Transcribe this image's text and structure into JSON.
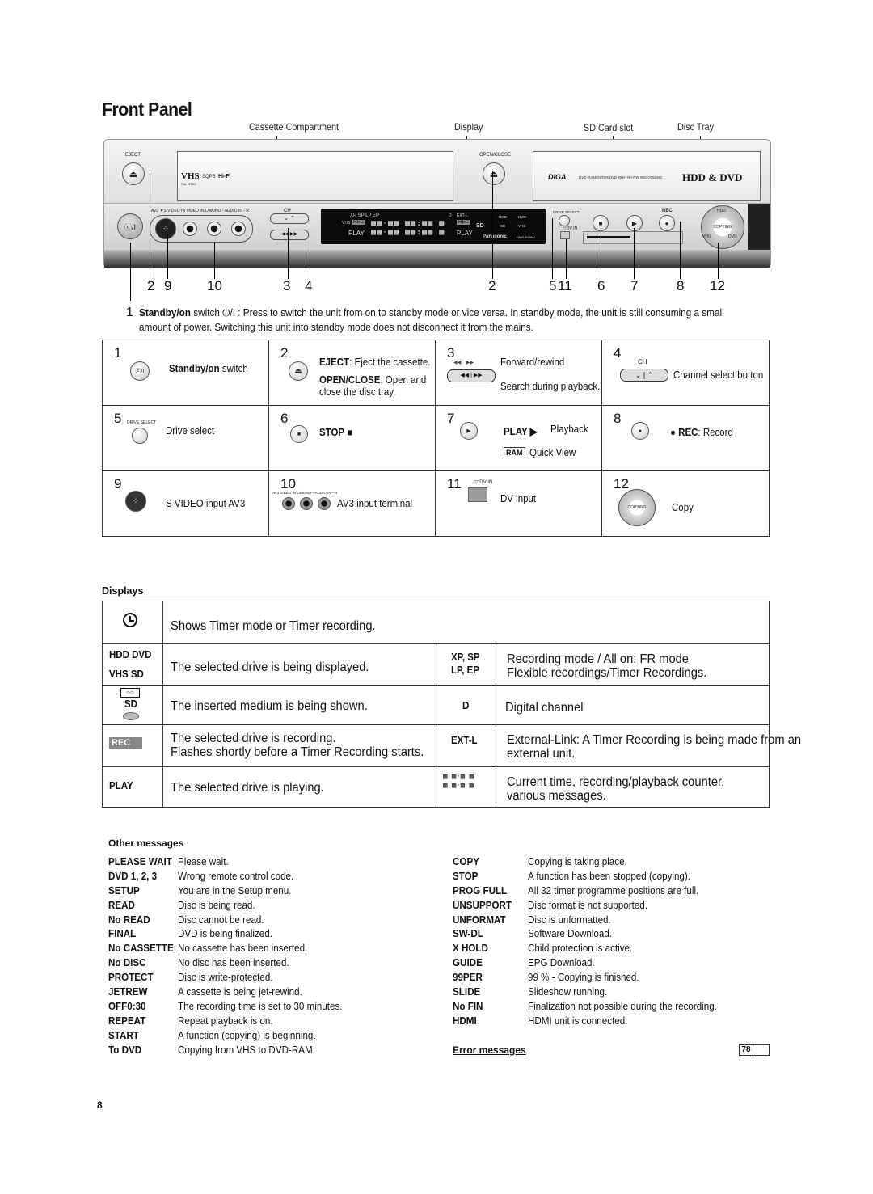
{
  "page_title": "Front Panel",
  "callouts_top": [
    "Cassette Compartment",
    "Display",
    "SD Card slot",
    "Disc Tray"
  ],
  "device": {
    "eject_label": "EJECT",
    "open_close_label": "OPEN/CLOSE",
    "vhs_logo": "VHS",
    "vhs_sub": "PAL NTSC",
    "sqpb": "SQPB",
    "hifi": "Hi-Fi",
    "brand": "DIGA",
    "formats": "DVD-RAM/DVD-R/DVD-RW/+R/+RW RECORDING",
    "hdd_dvd": "HDD & DVD",
    "av3_labels": "AV3  ▼S VIDEO IN  VIDEO IN  L/MONO - AUDIO IN - R",
    "ch_label": "CH",
    "standby_label": "ⓒ/I",
    "drive_select_label": "DRIVE SELECT",
    "dv_in_label": "▽DV IN",
    "rec_label": "REC",
    "copy_dial": {
      "top": "HDD",
      "center": "COPYING",
      "left": "VHS",
      "right": "DVD"
    },
    "lcd": {
      "modes": "XP SP  LP  EP",
      "d": "D",
      "extl": "EXT-L",
      "vhs": "VHS",
      "rec": "REC",
      "play": "PLAY",
      "sd": "SD",
      "drives": [
        "HDD",
        "DVD",
        "SD",
        "VHS"
      ],
      "maker": "Panasonic",
      "model": "DMR-EX95V"
    }
  },
  "callouts_bottom": [
    "1",
    "2",
    "9",
    "10",
    "3",
    "4",
    "2",
    "5",
    "11",
    "6",
    "7",
    "8",
    "12"
  ],
  "intro": {
    "number": "1",
    "bold": "Standby/on",
    "text": " switch ⏻/I : Press to switch the unit from on to standby mode or vice versa. In standby mode, the unit is still consuming a small",
    "text2": "amount of power. Switching this unit into standby mode does not disconnect it from the mains."
  },
  "grid": [
    {
      "n": "1",
      "icon": "standby-button-icon",
      "icon_text": "ⓒ/I",
      "bold": "Standby/on",
      "text": " switch"
    },
    {
      "n": "2",
      "icon": "eject-button-icon",
      "line1_bold": "EJECT",
      "line1": ": Eject the cassette.",
      "line2_bold": "OPEN/CLOSE",
      "line2": ": Open and",
      "line3": "close the disc tray."
    },
    {
      "n": "3",
      "icon": "rewind-forward-button-icon",
      "line1": "Forward/rewind",
      "line2": "Search during playback."
    },
    {
      "n": "4",
      "icon": "channel-button-icon",
      "icon_label": "CH",
      "text": "Channel select button"
    },
    {
      "n": "5",
      "icon": "drive-select-button-icon",
      "icon_label": "DRIVE SELECT",
      "text": "Drive select"
    },
    {
      "n": "6",
      "icon": "stop-button-icon",
      "bold": "STOP ■"
    },
    {
      "n": "7",
      "icon": "play-button-icon",
      "bold": "PLAY ▶",
      "text": "Playback",
      "badge": "RAM",
      "text2": "Quick View"
    },
    {
      "n": "8",
      "icon": "record-button-icon",
      "bold_prefix": "● REC",
      "text": ": Record"
    },
    {
      "n": "9",
      "icon": "s-video-terminal-icon",
      "text": "S VIDEO input AV3"
    },
    {
      "n": "10",
      "icon": "av3-terminals-icon",
      "icon_label": "AV3 VIDEO IN   L/MONO—AUDIO IN—R",
      "text": "AV3 input terminal"
    },
    {
      "n": "11",
      "icon": "dv-input-icon",
      "icon_label": "▽ DV IN",
      "text": "DV input"
    },
    {
      "n": "12",
      "icon": "copy-dial-icon",
      "text": "Copy"
    }
  ],
  "displays": {
    "heading": "Displays",
    "rows": [
      {
        "symbol": "timer-icon",
        "text": "Shows Timer mode or Timer recording."
      },
      {
        "symbol_lines": [
          "HDD   DVD",
          "VHS    SD"
        ],
        "text": "The selected drive is being displayed.",
        "right_symbol_lines": [
          "XP, SP",
          "LP, EP"
        ],
        "right_text": [
          "Recording mode / All on: FR mode",
          "Flexible recordings/Timer Recordings."
        ]
      },
      {
        "symbol_lines": [
          "SD"
        ],
        "text": "The inserted medium is being shown.",
        "right_symbol_lines": [
          "D"
        ],
        "right_text": [
          "Digital channel"
        ]
      },
      {
        "symbol_badge": "REC",
        "text_lines": [
          "The selected drive is recording.",
          "Flashes shortly before a Timer Recording starts."
        ],
        "right_symbol_lines": [
          "EXT-L"
        ],
        "right_text": [
          "External-Link: A Timer Recording is being made from an",
          "external unit."
        ]
      },
      {
        "symbol_lines": [
          "PLAY"
        ],
        "text": "The selected drive is playing.",
        "right_symbol": "segment-display-icon",
        "right_text": [
          "Current time, recording/playback counter,",
          "various messages."
        ]
      }
    ]
  },
  "other_messages": {
    "heading": "Other messages",
    "left": [
      {
        "k": "PLEASE WAIT",
        "v": "Please wait."
      },
      {
        "k": "DVD 1, 2, 3",
        "v": "Wrong remote control code."
      },
      {
        "k": "SETUP",
        "v": "You are in the Setup menu."
      },
      {
        "k": "READ",
        "v": "Disc is being read."
      },
      {
        "k": "No READ",
        "v": "Disc cannot be read."
      },
      {
        "k": "FINAL",
        "v": "DVD is being finalized."
      },
      {
        "k": "No CASSETTE",
        "v": "No cassette has been inserted."
      },
      {
        "k": "No DISC",
        "v": "No disc has been inserted."
      },
      {
        "k": "PROTECT",
        "v": "Disc is write-protected."
      },
      {
        "k": "JETREW",
        "v": "A  cassette is being jet-rewind."
      },
      {
        "k": "OFF0:30",
        "v": "The recording time is set to 30 minutes."
      },
      {
        "k": "REPEAT",
        "v": "Repeat playback is on."
      },
      {
        "k": "START",
        "v": "A function (copying) is beginning."
      },
      {
        "k": "To DVD",
        "v": "Copying from VHS to DVD-RAM."
      }
    ],
    "right": [
      {
        "k": "COPY",
        "v": "Copying is taking place."
      },
      {
        "k": "STOP",
        "v": "A function has been stopped (copying)."
      },
      {
        "k": "PROG FULL",
        "v": "All 32 timer programme positions are full."
      },
      {
        "k": "UNSUPPORT",
        "v": "Disc format is not supported."
      },
      {
        "k": "UNFORMAT",
        "v": "Disc is unformatted."
      },
      {
        "k": "SW-DL",
        "v": "Software Download."
      },
      {
        "k": "X HOLD",
        "v": "Child protection is active."
      },
      {
        "k": "GUIDE",
        "v": "EPG Download."
      },
      {
        "k": "99PER",
        "v": "99 % - Copying is finished."
      },
      {
        "k": "SLIDE",
        "v": "Slideshow running."
      },
      {
        "k": "No FIN",
        "v": "Finalization not possible during the recording."
      },
      {
        "k": "HDMI",
        "v": "HDMI unit is connected."
      }
    ],
    "error_link": "Error messages",
    "page_ref": "78"
  },
  "page_number": "8"
}
